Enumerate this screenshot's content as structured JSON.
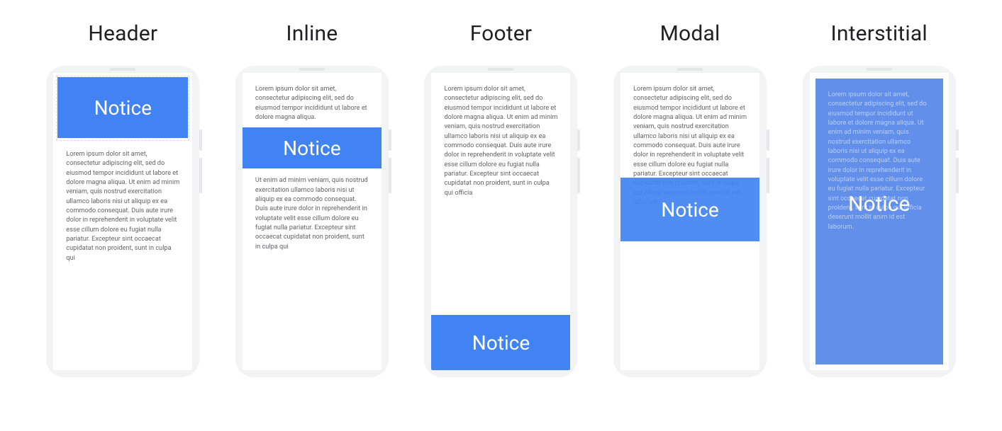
{
  "notice_word": "Notice",
  "variants": [
    {
      "title": "Header"
    },
    {
      "title": "Inline"
    },
    {
      "title": "Footer"
    },
    {
      "title": "Modal"
    },
    {
      "title": "Interstitial"
    }
  ],
  "lorem": {
    "short": "Lorem ipsum dolor sit amet, consectetur adipiscing elit, sed do eiusmod tempor incididunt ut labore et dolore magna aliqua.",
    "para1": "Lorem ipsum dolor sit amet, consectetur adipiscing elit, sed do eiusmod tempor incididunt ut labore et dolore magna aliqua. Ut enim ad minim veniam, quis nostrud exercitation ullamco laboris nisi ut aliquip ex ea commodo consequat. Duis aute irure dolor in reprehenderit in voluptate velit esse cillum dolore eu fugiat nulla pariatur. Excepteur sint occaecat cupidatat non proident, sunt in culpa qui",
    "para2": "Ut enim ad minim veniam, quis nostrud exercitation ullamco laboris nisi ut aliquip ex ea commodo consequat. Duis aute irure dolor in reprehenderit in voluptate velit esse cillum dolore eu fugiat nulla pariatur. Excepteur sint occaecat cupidatat non proident, sunt in culpa qui",
    "long": "Lorem ipsum dolor sit amet, consectetur adipiscing elit, sed do eiusmod tempor incididunt ut labore et dolore magna aliqua. Ut enim ad minim veniam, quis nostrud exercitation ullamco laboris nisi ut aliquip ex ea commodo consequat. Duis aute irure dolor in reprehenderit in voluptate velit esse cillum dolore eu fugiat nulla pariatur. Excepteur sint occaecat cupidatat non proident, sunt in culpa qui officia",
    "longer": "Lorem ipsum dolor sit amet, consectetur adipiscing elit, sed do eiusmod tempor incididunt ut labore et dolore magna aliqua. Ut enim ad minim veniam, quis nostrud exercitation ullamco laboris nisi ut aliquip ex ea commodo consequat. Duis aute irure dolor in reprehenderit in voluptate velit esse cillum dolore eu fugiat nulla pariatur. Excepteur sint occaecat cupidatat non proident, sunt in culpa qui officia deserunt mollit anim id est laborum."
  }
}
